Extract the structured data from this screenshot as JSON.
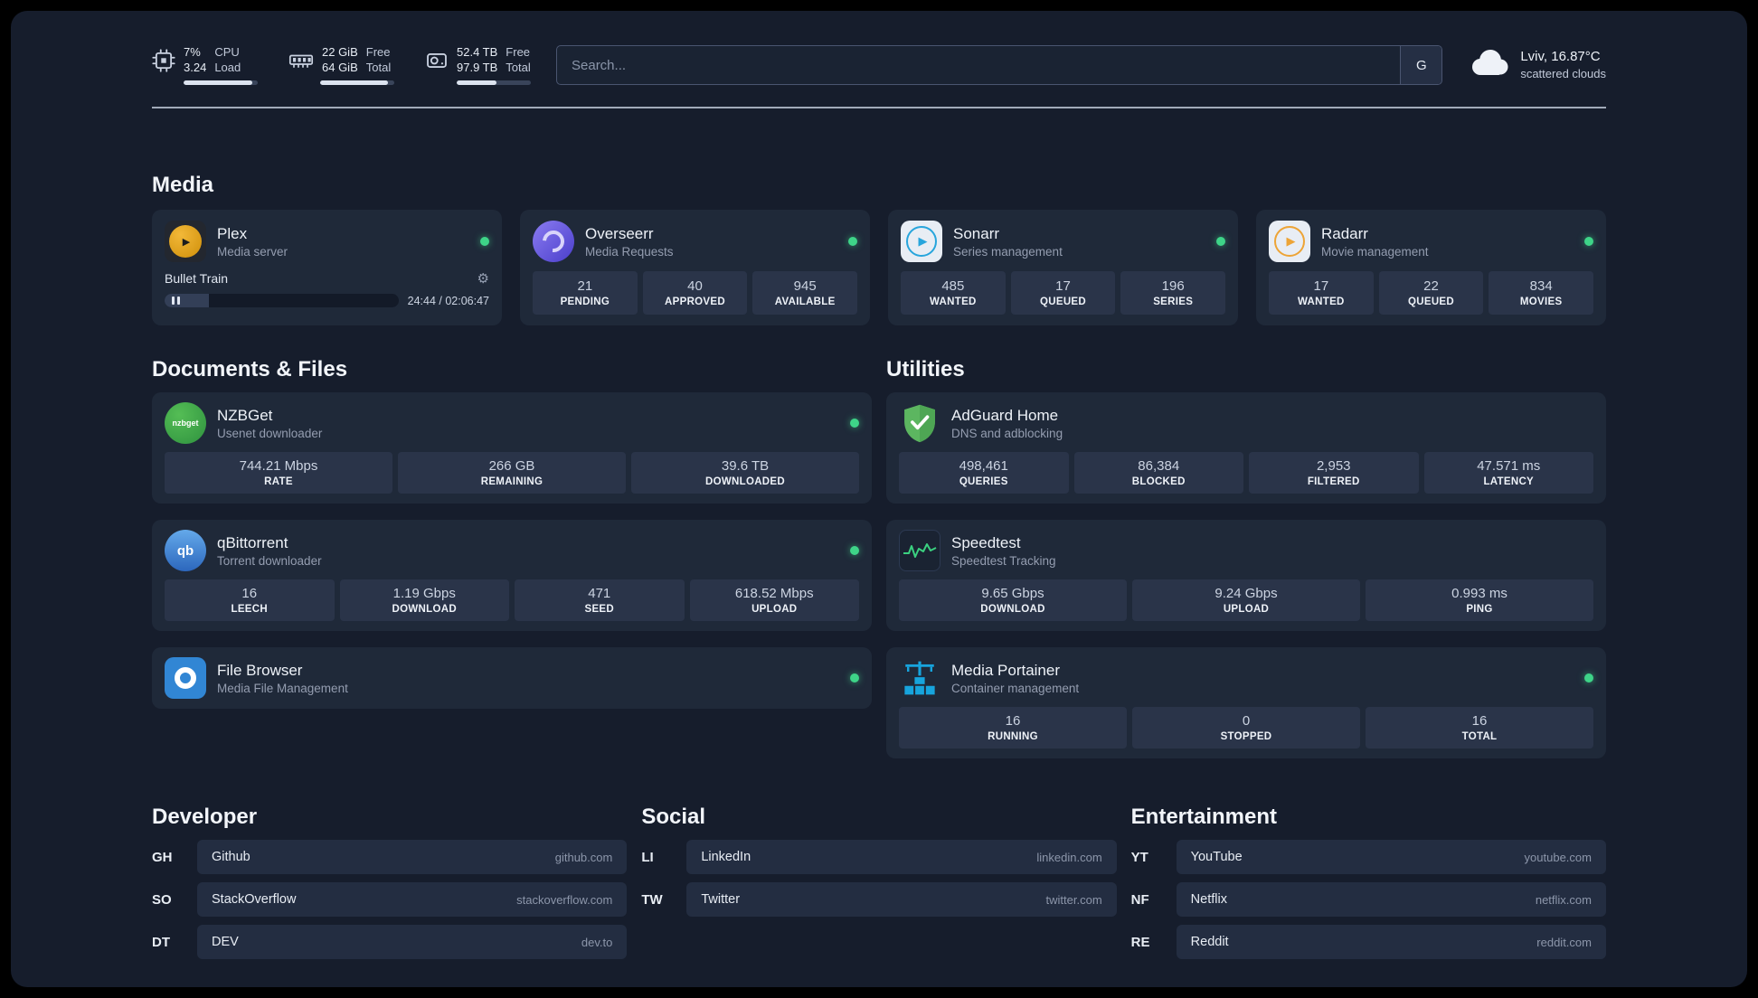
{
  "topbar": {
    "cpu": {
      "values": [
        "7%",
        "3.24"
      ],
      "labels": [
        "CPU",
        "Load"
      ],
      "bar_percent": 93
    },
    "memory": {
      "values": [
        "22 GiB",
        "64 GiB"
      ],
      "labels": [
        "Free",
        "Total"
      ],
      "bar_percent": 92
    },
    "disk": {
      "values": [
        "52.4 TB",
        "97.9 TB"
      ],
      "labels": [
        "Free",
        "Total"
      ],
      "bar_percent": 54
    },
    "search": {
      "placeholder": "Search...",
      "button_label": "G"
    },
    "weather": {
      "location": "Lviv, 16.87°C",
      "condition": "scattered clouds"
    }
  },
  "media": {
    "title": "Media",
    "plex": {
      "name": "Plex",
      "subtitle": "Media server",
      "status": "online",
      "now_playing": "Bullet Train",
      "elapsed_total": "24:44 / 02:06:47",
      "progress_percent": 19
    },
    "overseerr": {
      "name": "Overseerr",
      "subtitle": "Media Requests",
      "status": "online",
      "stats": [
        {
          "value": "21",
          "label": "PENDING"
        },
        {
          "value": "40",
          "label": "APPROVED"
        },
        {
          "value": "945",
          "label": "AVAILABLE"
        }
      ]
    },
    "sonarr": {
      "name": "Sonarr",
      "subtitle": "Series management",
      "status": "online",
      "stats": [
        {
          "value": "485",
          "label": "WANTED"
        },
        {
          "value": "17",
          "label": "QUEUED"
        },
        {
          "value": "196",
          "label": "SERIES"
        }
      ]
    },
    "radarr": {
      "name": "Radarr",
      "subtitle": "Movie management",
      "status": "online",
      "stats": [
        {
          "value": "17",
          "label": "WANTED"
        },
        {
          "value": "22",
          "label": "QUEUED"
        },
        {
          "value": "834",
          "label": "MOVIES"
        }
      ]
    }
  },
  "documents": {
    "title": "Documents & Files",
    "nzbget": {
      "name": "NZBGet",
      "subtitle": "Usenet downloader",
      "status": "online",
      "stats": [
        {
          "value": "744.21 Mbps",
          "label": "RATE"
        },
        {
          "value": "266 GB",
          "label": "REMAINING"
        },
        {
          "value": "39.6 TB",
          "label": "DOWNLOADED"
        }
      ]
    },
    "qbittorrent": {
      "name": "qBittorrent",
      "subtitle": "Torrent downloader",
      "status": "online",
      "stats": [
        {
          "value": "16",
          "label": "LEECH"
        },
        {
          "value": "1.19 Gbps",
          "label": "DOWNLOAD"
        },
        {
          "value": "471",
          "label": "SEED"
        },
        {
          "value": "618.52 Mbps",
          "label": "UPLOAD"
        }
      ]
    },
    "filebrowser": {
      "name": "File Browser",
      "subtitle": "Media File Management",
      "status": "online"
    }
  },
  "utilities": {
    "title": "Utilities",
    "adguard": {
      "name": "AdGuard Home",
      "subtitle": "DNS and adblocking",
      "stats": [
        {
          "value": "498,461",
          "label": "QUERIES"
        },
        {
          "value": "86,384",
          "label": "BLOCKED"
        },
        {
          "value": "2,953",
          "label": "FILTERED"
        },
        {
          "value": "47.571 ms",
          "label": "LATENCY"
        }
      ]
    },
    "speedtest": {
      "name": "Speedtest",
      "subtitle": "Speedtest Tracking",
      "stats": [
        {
          "value": "9.65 Gbps",
          "label": "DOWNLOAD"
        },
        {
          "value": "9.24 Gbps",
          "label": "UPLOAD"
        },
        {
          "value": "0.993 ms",
          "label": "PING"
        }
      ]
    },
    "portainer": {
      "name": "Media Portainer",
      "subtitle": "Container management",
      "status": "online",
      "stats": [
        {
          "value": "16",
          "label": "RUNNING"
        },
        {
          "value": "0",
          "label": "STOPPED"
        },
        {
          "value": "16",
          "label": "TOTAL"
        }
      ]
    }
  },
  "bookmarks": {
    "developer": {
      "title": "Developer",
      "items": [
        {
          "abbr": "GH",
          "name": "Github",
          "url": "github.com"
        },
        {
          "abbr": "SO",
          "name": "StackOverflow",
          "url": "stackoverflow.com"
        },
        {
          "abbr": "DT",
          "name": "DEV",
          "url": "dev.to"
        }
      ]
    },
    "social": {
      "title": "Social",
      "items": [
        {
          "abbr": "LI",
          "name": "LinkedIn",
          "url": "linkedin.com"
        },
        {
          "abbr": "TW",
          "name": "Twitter",
          "url": "twitter.com"
        }
      ]
    },
    "entertainment": {
      "title": "Entertainment",
      "items": [
        {
          "abbr": "YT",
          "name": "YouTube",
          "url": "youtube.com"
        },
        {
          "abbr": "NF",
          "name": "Netflix",
          "url": "netflix.com"
        },
        {
          "abbr": "RE",
          "name": "Reddit",
          "url": "reddit.com"
        }
      ]
    }
  },
  "colors": {
    "status_online": "#3ed488",
    "speedtest_line": "#3bd080",
    "page_bg": "#161d2c",
    "card_bg": "#1f2939"
  }
}
